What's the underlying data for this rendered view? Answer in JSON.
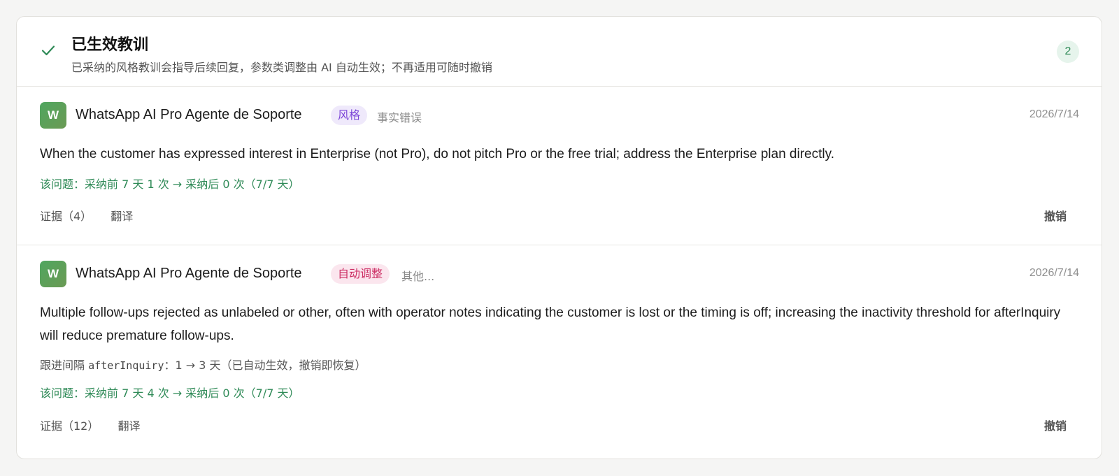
{
  "header": {
    "title": "已生效教训",
    "subtitle": "已采纳的风格教训会指导后续回复，参数类调整由 AI 自动生效；不再适用可随时撤销",
    "count": "2",
    "icon": "check-icon"
  },
  "colors": {
    "accent_green": "#2f8a57",
    "style_tag": "#7c45d8",
    "auto_tag": "#cc2f64"
  },
  "lessons": [
    {
      "avatar": "W",
      "agent": "WhatsApp AI Pro Agente de Soporte",
      "tag": "风格",
      "category": "事实错误",
      "date": "2026/7/14",
      "text": "When the customer has expressed interest in Enterprise (not Pro), do not pitch Pro or the free trial; address the Enterprise plan directly.",
      "stat": "该问题：采纳前 7 天 1 次 → 采纳后 0 次（7/7 天）",
      "evidence": "证据（4）",
      "translate": "翻译",
      "revoke": "撤销"
    },
    {
      "avatar": "W",
      "agent": "WhatsApp AI Pro Agente de Soporte",
      "tag": "自动调整",
      "category": "其他...",
      "date": "2026/7/14",
      "text": "Multiple follow-ups rejected as unlabeled or other, often with operator notes indicating the customer is lost or the timing is off; increasing the inactivity threshold for afterInquiry will reduce premature follow-ups.",
      "param_label": "跟进间隔",
      "param_key": "afterInquiry",
      "param_value": "：1 → 3 天（已自动生效，撤销即恢复）",
      "stat": "该问题：采纳前 7 天 4 次 → 采纳后 0 次（7/7 天）",
      "evidence": "证据（12）",
      "translate": "翻译",
      "revoke": "撤销"
    }
  ]
}
